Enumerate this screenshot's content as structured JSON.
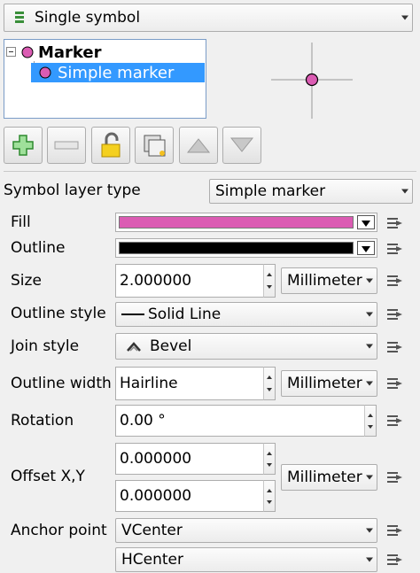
{
  "renderer": {
    "selected": "Single symbol"
  },
  "tree": {
    "root_label": "Marker",
    "child_label": "Simple marker",
    "selection_color": "#3399ff"
  },
  "preview": {
    "marker_color": "#db5cb3"
  },
  "toolbar": [
    {
      "name": "add-layer-button",
      "icon": "plus-icon"
    },
    {
      "name": "remove-layer-button",
      "icon": "minus-icon"
    },
    {
      "name": "lock-layer-button",
      "icon": "lock-icon"
    },
    {
      "name": "duplicate-layer-button",
      "icon": "duplicate-icon"
    },
    {
      "name": "move-up-button",
      "icon": "arrow-up-icon"
    },
    {
      "name": "move-down-button",
      "icon": "arrow-down-icon"
    }
  ],
  "symbol_layer_type": {
    "label": "Symbol layer type",
    "value": "Simple marker"
  },
  "fill": {
    "label": "Fill",
    "color": "#db5cb3"
  },
  "outline": {
    "label": "Outline",
    "color": "#000000"
  },
  "size": {
    "label": "Size",
    "value": "2.000000",
    "unit": "Millimeter"
  },
  "outline_style": {
    "label": "Outline style",
    "value": "Solid Line"
  },
  "join_style": {
    "label": "Join style",
    "value": "Bevel"
  },
  "outline_width": {
    "label": "Outline width",
    "value": "Hairline",
    "unit": "Millimeter"
  },
  "rotation": {
    "label": "Rotation",
    "value": "0.00 °"
  },
  "offset": {
    "label": "Offset X,Y",
    "x": "0.000000",
    "y": "0.000000",
    "unit": "Millimeter"
  },
  "anchor": {
    "label": "Anchor point",
    "vertical": "VCenter",
    "horizontal": "HCenter"
  }
}
